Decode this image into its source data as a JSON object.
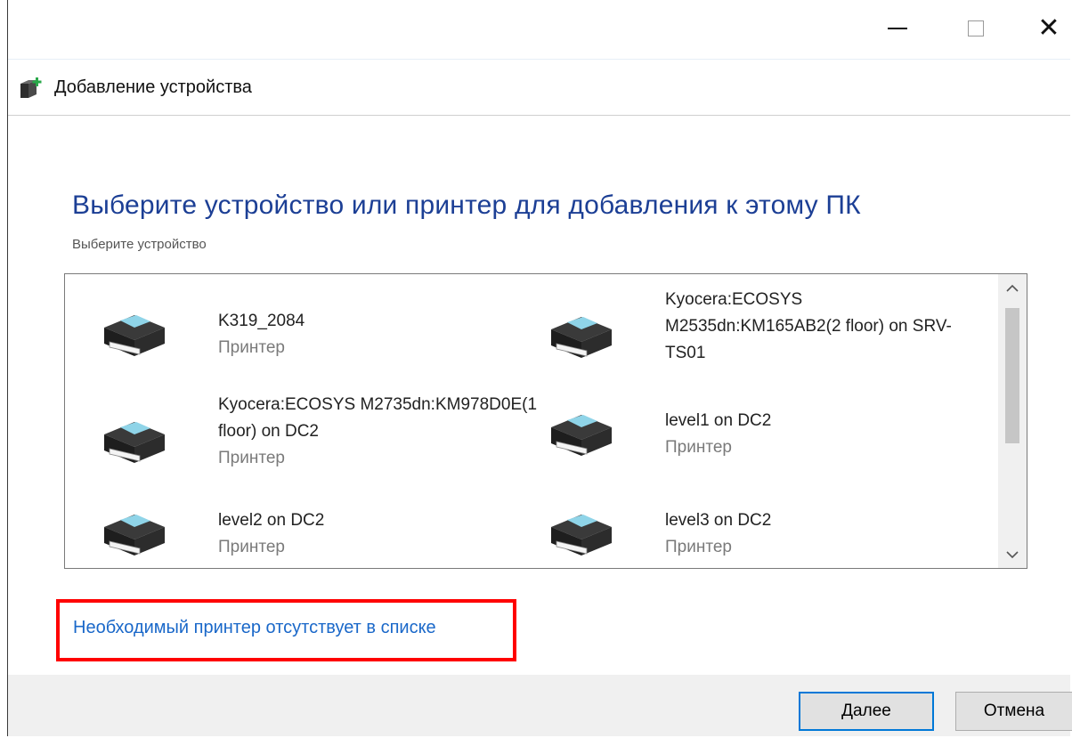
{
  "window": {
    "title": "Добавление устройства",
    "controls": {
      "minimize": "—",
      "maximize": "☐",
      "close": "✕"
    }
  },
  "main": {
    "heading": "Выберите устройство или принтер для добавления к этому ПК",
    "subheading": "Выберите устройство"
  },
  "devices": [
    {
      "name": "K319_2084",
      "type": "Принтер"
    },
    {
      "name": "Kyocera:ECOSYS M2535dn:KM165AB2(2 floor) on SRV-TS01",
      "type": ""
    },
    {
      "name": "Kyocera:ECOSYS M2735dn:KM978D0E(1 floor) on DC2",
      "type": "Принтер"
    },
    {
      "name": "level1 on DC2",
      "type": "Принтер"
    },
    {
      "name": "level2 on DC2",
      "type": "Принтер"
    },
    {
      "name": "level3 on DC2",
      "type": "Принтер"
    }
  ],
  "links": {
    "missing_printer": "Необходимый принтер отсутствует в списке"
  },
  "buttons": {
    "next": "Далее",
    "cancel": "Отмена"
  },
  "colors": {
    "heading": "#1c3f95",
    "link": "#1a68c9",
    "highlight": "#ff0000",
    "default_button_border": "#0078d7"
  }
}
